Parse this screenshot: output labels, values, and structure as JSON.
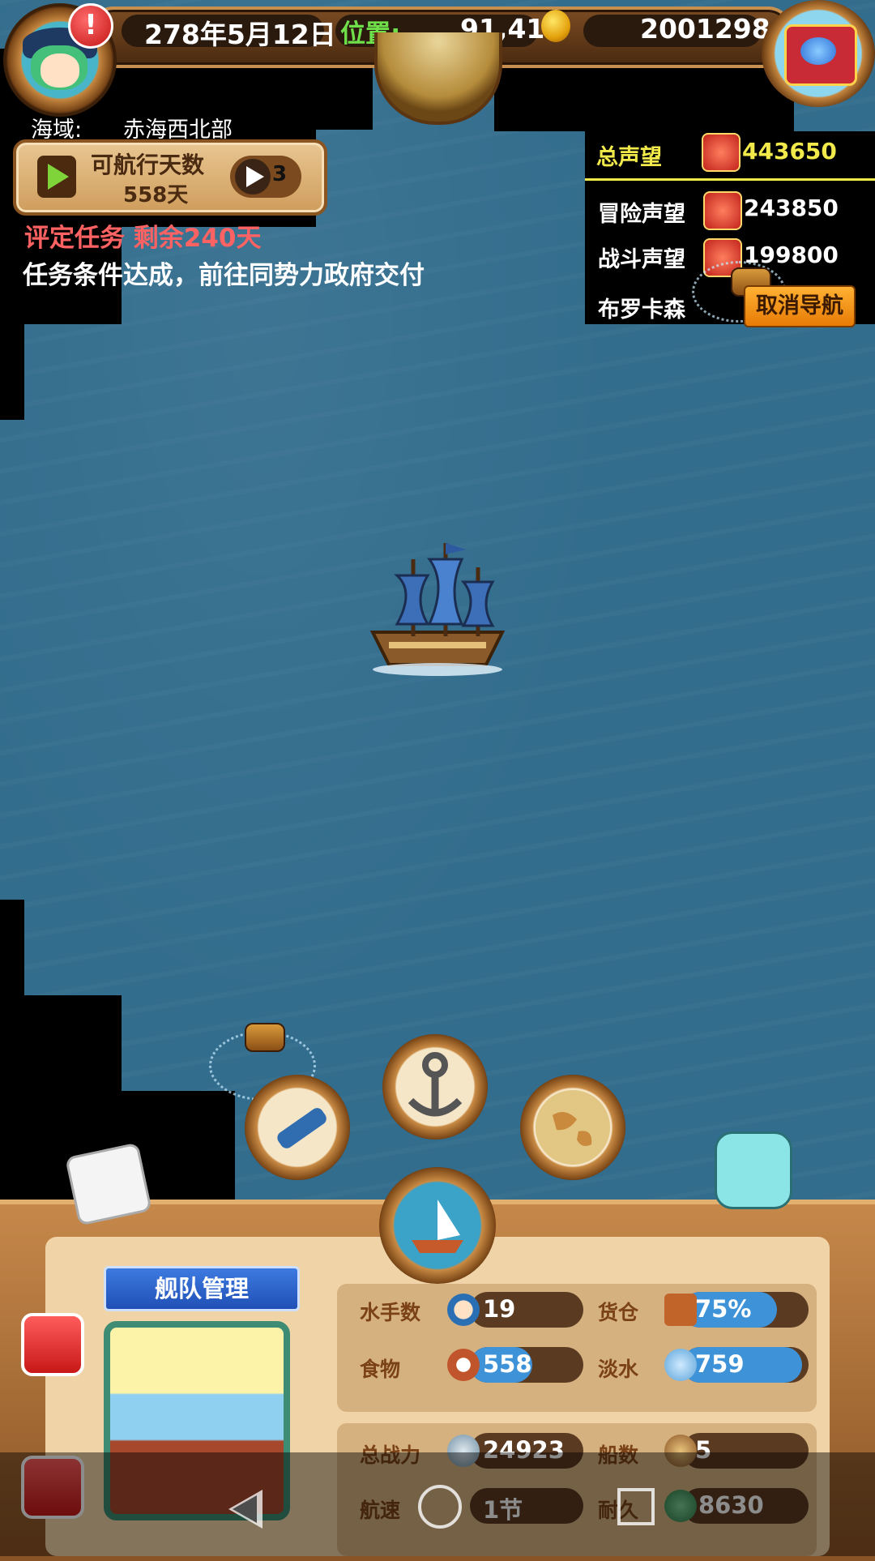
{
  "top": {
    "date": "278年5月12日",
    "position_label": "位置:",
    "position_value": "91,41",
    "gold": "2001298"
  },
  "sea_area": {
    "label": "海域:",
    "value": "赤海西北部"
  },
  "voyage": {
    "label": "可航行天数",
    "days": "558天",
    "speed": "3"
  },
  "task": {
    "line1": "评定任务 剩余240天",
    "line2": "任务条件达成，前往同势力政府交付"
  },
  "reputation": {
    "total_label": "总声望",
    "total_value": "443650",
    "adventure_label": "冒险声望",
    "adventure_value": "243850",
    "battle_label": "战斗声望",
    "battle_value": "199800",
    "destination": "布罗卡森",
    "cancel_nav": "取消导航"
  },
  "fleet": {
    "title": "舰队管理",
    "sailors_label": "水手数",
    "sailors": "19",
    "cargo_label": "货仓",
    "cargo": "75%",
    "cargo_fill": 0.75,
    "food_label": "食物",
    "food": "558",
    "food_fill": 0.55,
    "water_label": "淡水",
    "water": "759",
    "water_fill": 0.95,
    "power_label": "总战力",
    "power": "24923",
    "ships_label": "船数",
    "ships": "5",
    "speed_label": "航速",
    "speed": "1节",
    "durability_label": "耐久",
    "durability": "8630"
  },
  "colors": {
    "sea": "#336d8d",
    "accent_yellow": "#f1ea4a",
    "task_red": "#ff6262",
    "bar_blue": "#3d92d8"
  },
  "icons": [
    "avatar",
    "alert-icon",
    "coin-icon",
    "treasure-chest-icon",
    "telescope-icon",
    "anchor-icon",
    "world-map-icon",
    "sail-ship-icon",
    "back-icon",
    "home-icon",
    "recent-apps-icon"
  ]
}
